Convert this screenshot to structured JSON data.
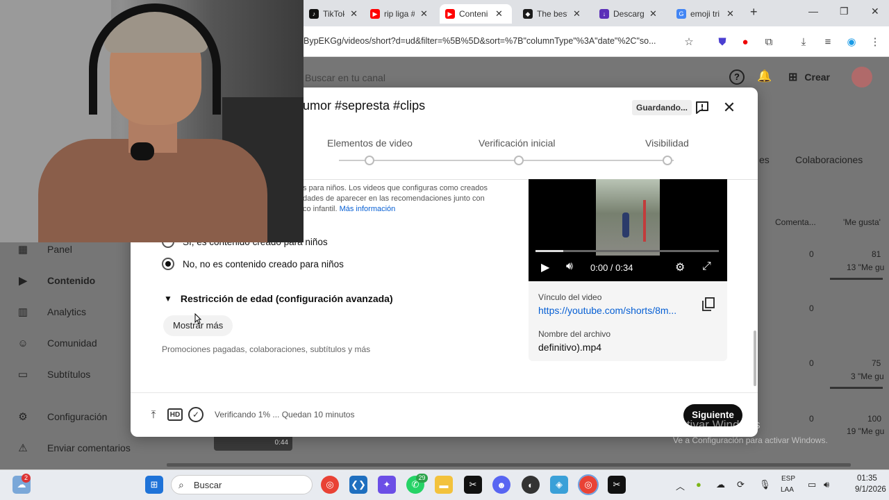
{
  "browser": {
    "tabs": [
      {
        "label": "TikTok -",
        "color": "#111111",
        "glyph": "♪"
      },
      {
        "label": "rip liga #",
        "color": "#ff0000",
        "glyph": "▶"
      },
      {
        "label": "Conteni",
        "color": "#ff0000",
        "glyph": "▶"
      },
      {
        "label": "The best",
        "color": "#1b1b1b",
        "glyph": "◆"
      },
      {
        "label": "Descarg",
        "color": "#5b2fb8",
        "glyph": "↓"
      },
      {
        "label": "emoji tri",
        "color": "#4285f4",
        "glyph": "G"
      }
    ],
    "new_tab": "+",
    "url": "BypEKGg/videos/short?d=ud&filter=%5B%5D&sort=%7B\"columnType\"%3A\"date\"%2C\"so..."
  },
  "studio": {
    "search_placeholder": "Buscar en tu canal",
    "create_label": "Crear",
    "sidebar": [
      {
        "label": "Panel",
        "icon": "dashboard-icon"
      },
      {
        "label": "Contenido",
        "icon": "content-icon",
        "active": true
      },
      {
        "label": "Analytics",
        "icon": "analytics-icon"
      },
      {
        "label": "Comunidad",
        "icon": "community-icon"
      },
      {
        "label": "Subtítulos",
        "icon": "subtitles-icon"
      },
      {
        "label": "Configuración",
        "icon": "gear-icon"
      },
      {
        "label": "Enviar comentarios",
        "icon": "feedback-icon"
      }
    ],
    "bg_tabs": {
      "es": "es",
      "colaboraciones": "Colaboraciones"
    },
    "columns": {
      "comments": "Comenta...",
      "likes": "'Me gusta'"
    },
    "rows": [
      {
        "comments": "0",
        "likes": "81",
        "likes_sub": "13 \"Me gu"
      },
      {
        "comments": "0",
        "likes": "",
        "likes_sub": ""
      },
      {
        "comments": "0",
        "likes": "75",
        "likes_sub": "3 \"Me gu"
      },
      {
        "comments": "0",
        "likes": "100",
        "likes_sub": "19 \"Me gu"
      }
    ],
    "thumb_duration": "0:44"
  },
  "dialog": {
    "title": "umor #sepresta #clips",
    "saving": "Guardando...",
    "steps": [
      "Elementos de video",
      "Verificación inicial",
      "Visibilidad"
    ],
    "kids_note_lines": [
      "s para niños. Los videos que configuras como creados",
      "dades de aparecer en las recomendaciones junto con",
      "co infantil."
    ],
    "kids_note_link": "Más información",
    "radio_yes": "Sí, es contenido creado para niños",
    "radio_no": "No, no es contenido creado para niños",
    "age_restriction": "Restricción de edad (configuración avanzada)",
    "show_more": "Mostrar más",
    "more_desc": "Promociones pagadas, colaboraciones, subtítulos y más",
    "video": {
      "time": "0:00 / 0:34",
      "progress": 0.15,
      "link_label": "Vínculo del video",
      "link_url": "https://youtube.com/shorts/8m...",
      "file_label": "Nombre del archivo",
      "file_name": "definitivo).mp4"
    },
    "status": "Verificando 1% ... Quedan 10 minutos",
    "next_label": "Siguiente"
  },
  "windows": {
    "watermark_title": "Activar Windows",
    "watermark_sub": "Ve a Configuración para activar Windows.",
    "search_label": "Buscar",
    "lang1": "ESP",
    "lang2": "LAA",
    "time": "01:35",
    "date": "9/1/2026",
    "weather_badge": "2",
    "whatsapp_badge": "29"
  }
}
